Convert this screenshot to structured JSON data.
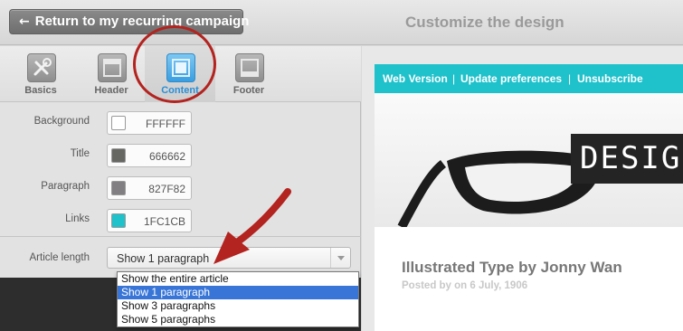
{
  "header": {
    "back_label": "Return to my recurring campaign",
    "title": "Customize the design"
  },
  "tabs": [
    {
      "label": "Basics",
      "icon": "wrench-screwdriver-icon"
    },
    {
      "label": "Header",
      "icon": "header-layout-icon"
    },
    {
      "label": "Content",
      "icon": "content-layout-icon",
      "active": true
    },
    {
      "label": "Footer",
      "icon": "footer-layout-icon"
    }
  ],
  "colors": [
    {
      "label": "Background",
      "value": "FFFFFF",
      "swatch": "#FFFFFF"
    },
    {
      "label": "Title",
      "value": "666662",
      "swatch": "#666662"
    },
    {
      "label": "Paragraph",
      "value": "827F82",
      "swatch": "#827F82"
    },
    {
      "label": "Links",
      "value": "1FC1CB",
      "swatch": "#1FC1CB"
    }
  ],
  "article_length": {
    "label": "Article length",
    "selected": "Show 1 paragraph",
    "options": [
      "Show the entire article",
      "Show 1 paragraph",
      "Show 3 paragraphs",
      "Show 5 paragraphs"
    ],
    "selected_index": 1
  },
  "preview": {
    "links": [
      "Web Version",
      "Update preferences",
      "Unsubscribe"
    ],
    "separator": "|",
    "hero_text": "DESIGN",
    "article_title": "Illustrated Type by Jonny Wan",
    "article_meta": "Posted by on 6 July, 1906"
  },
  "accent_colors": {
    "active_tab": "#2a8fd6",
    "annotation_red": "#b3231f",
    "email_bar": "#1fc1cb",
    "dropdown_selected": "#3875d7"
  }
}
